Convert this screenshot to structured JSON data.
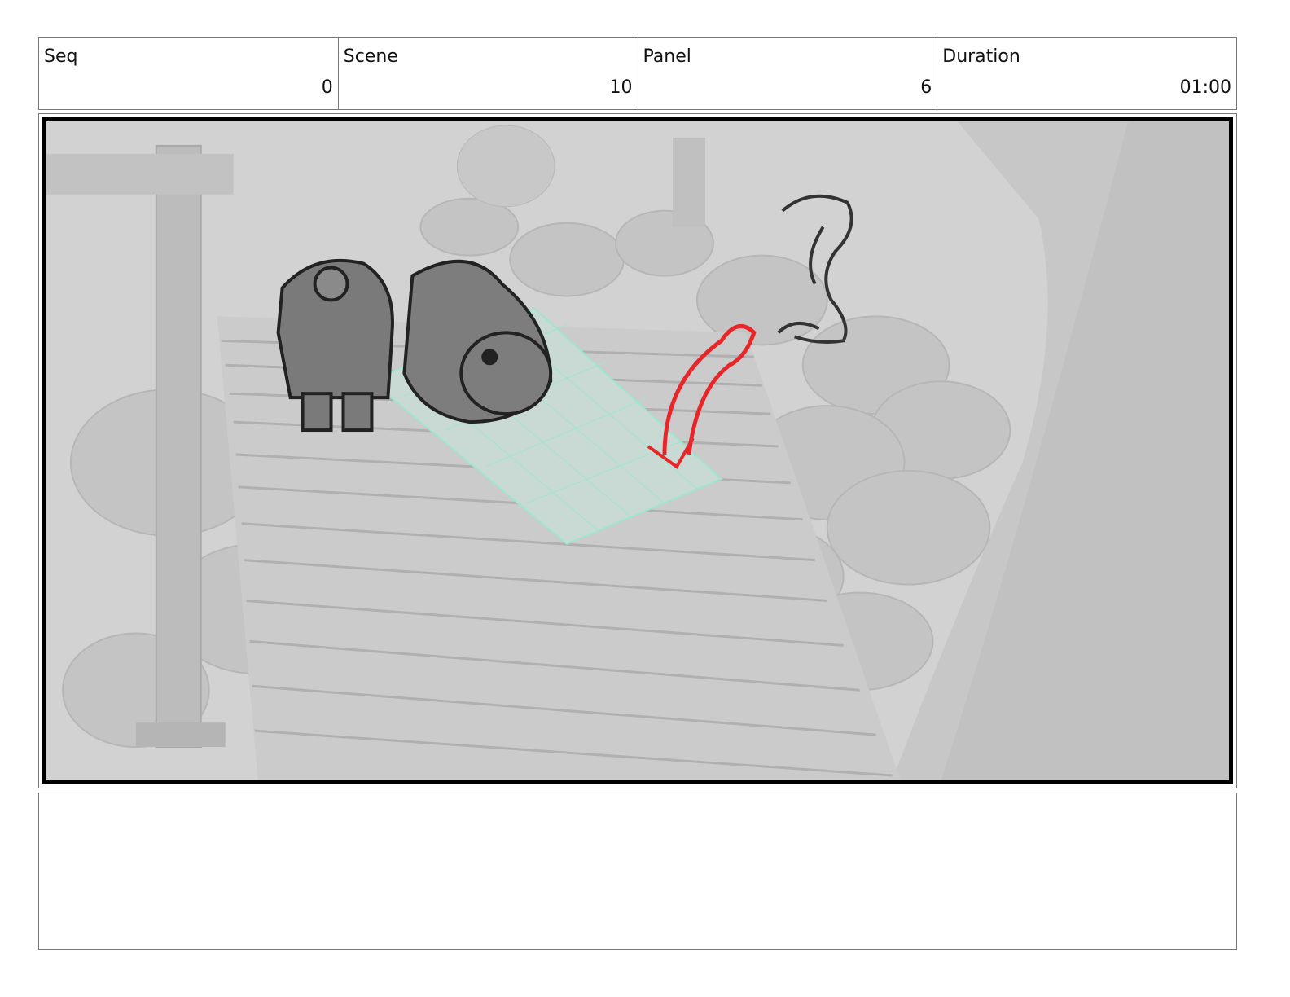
{
  "header": {
    "seq": {
      "label": "Seq",
      "value": "0"
    },
    "scene": {
      "label": "Scene",
      "value": "10"
    },
    "panel": {
      "label": "Panel",
      "value": "6"
    },
    "duration": {
      "label": "Duration",
      "value": "01:00"
    }
  },
  "panel_image": {
    "icon": "storyboard-scene-image",
    "colors": {
      "background": "#cfcfcf",
      "sketch": "#333333",
      "action_arrow": "#e8262a",
      "grid": "#9ee6cf",
      "frame": "#000000"
    }
  },
  "notes": {
    "text": ""
  }
}
